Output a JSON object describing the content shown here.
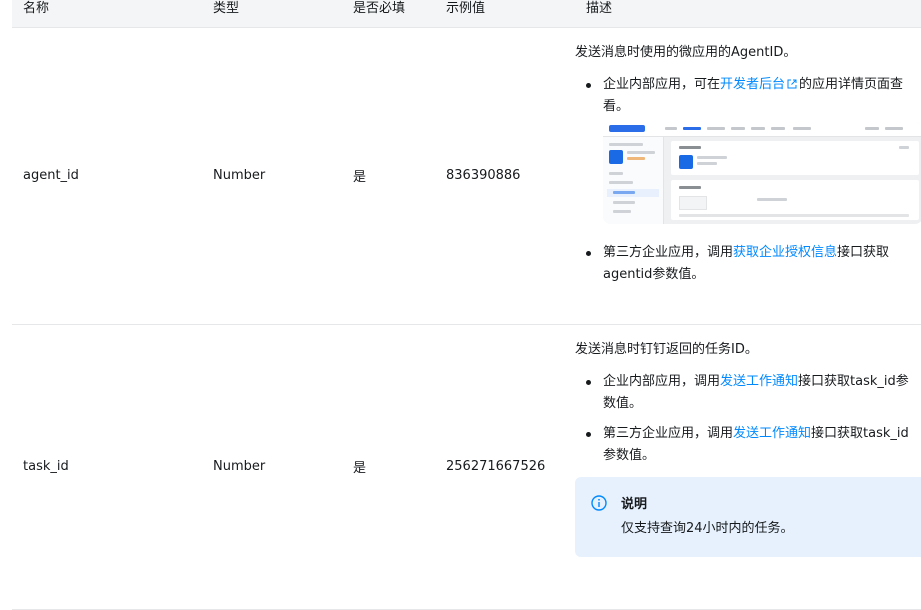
{
  "table": {
    "headers": [
      "名称",
      "类型",
      "是否必填",
      "示例值",
      "描述"
    ],
    "rows": [
      {
        "name": "agent_id",
        "type": "Number",
        "required": "是",
        "example": "836390886",
        "desc_intro": "发送消息时使用的微应用的AgentID。",
        "bullet1_a": "企业内部应用，可在",
        "bullet1_link": "开发者后台",
        "bullet1_b": "的应用详情页面查看。",
        "bullet2_a": "第三方企业应用，调用",
        "bullet2_link": "获取企业授权信息",
        "bullet2_b": "接口获取agentid参数值。"
      },
      {
        "name": "task_id",
        "type": "Number",
        "required": "是",
        "example": "256271667526",
        "desc_intro": "发送消息时钉钉返回的任务ID。",
        "bullet1_a": "企业内部应用，调用",
        "bullet1_link": "发送工作通知",
        "bullet1_b": "接口获取task_id参数值。",
        "bullet2_a": "第三方企业应用，调用",
        "bullet2_link": "发送工作通知",
        "bullet2_b": "接口获取task_id参数值。",
        "note_title": "说明",
        "note_text": "仅支持查询24小时内的任务。"
      }
    ]
  },
  "colors": {
    "link": "#0089ff",
    "note_bg": "#e6f1fd",
    "header_bg": "#f4f5f6"
  },
  "icons": [
    "external-link-icon",
    "info-icon"
  ]
}
